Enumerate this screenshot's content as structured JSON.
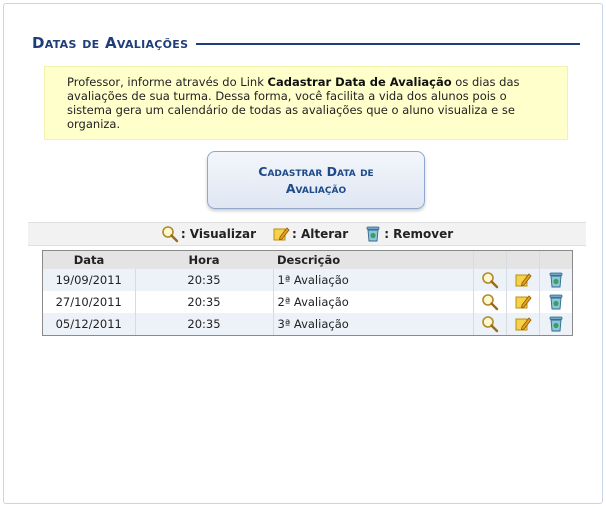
{
  "header": {
    "title": "Datas de Avaliações"
  },
  "info": {
    "text_before": "Professor, informe através do Link ",
    "link_text": "Cadastrar Data de Avaliação",
    "text_after": " os dias das avaliações de sua turma. Dessa forma, você facilita a vida dos alunos pois o sistema gera um calendário de todas as avaliações que o aluno visualiza e se organiza."
  },
  "button": {
    "label_line1": "Cadastrar Data de",
    "label_line2": "Avaliação"
  },
  "legend": {
    "view_label": ": Visualizar",
    "edit_label": ": Alterar",
    "remove_label": ": Remover"
  },
  "table": {
    "headers": {
      "date": "Data",
      "time": "Hora",
      "description": "Descrição"
    },
    "rows": [
      {
        "date": "19/09/2011",
        "time": "20:35",
        "description": "1ª Avaliação"
      },
      {
        "date": "27/10/2011",
        "time": "20:35",
        "description": "2ª Avaliação"
      },
      {
        "date": "05/12/2011",
        "time": "20:35",
        "description": "3ª Avaliação"
      }
    ]
  },
  "icons": {
    "view": "magnifier-icon",
    "edit": "pencil-note-icon",
    "remove": "recycle-bin-icon"
  },
  "colors": {
    "title": "#1f3d7a",
    "info_bg": "#ffffcc",
    "row_alt": "#edf1f8"
  }
}
